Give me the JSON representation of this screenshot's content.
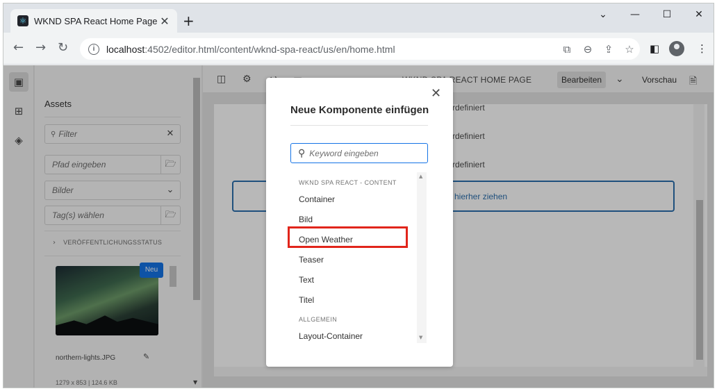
{
  "browser": {
    "tab_title": "WKND SPA React Home Page",
    "tab_close": "✕",
    "new_tab": "+",
    "window_controls": {
      "dropdown": "⌄",
      "minimize": "—",
      "maximize": "☐",
      "close": "✕"
    },
    "url_host": "localhost",
    "url_path": ":4502/editor.html/content/wknd-spa-react/us/en/home.html",
    "icons": [
      "back-icon",
      "forward-icon",
      "reload-icon",
      "site-info-icon",
      "translate-icon",
      "zoom-icon",
      "share-icon",
      "bookmark-star-icon",
      "side-panel-icon",
      "profile-icon",
      "menu-icon"
    ]
  },
  "rail": {
    "icons": [
      "assets-icon",
      "components-icon",
      "content-tree-icon"
    ]
  },
  "assets_panel": {
    "title": "Assets",
    "filter_placeholder": "Filter",
    "path_placeholder": "Pfad eingeben",
    "type_select": "Bilder",
    "tags_placeholder": "Tag(s) wählen",
    "status_section": "VERÖFFENTLICHUNGSSTATUS",
    "asset": {
      "badge": "Neu",
      "name": "northern-lights.JPG",
      "meta": "1279 x 853 | 124.6 KB"
    }
  },
  "editor": {
    "page_title": "WKND SPA REACT HOME PAGE",
    "mode_edit": "Bearbeiten",
    "mode_preview": "Vorschau",
    "canvas_lines": [
      "rdefiniert",
      "rdefiniert",
      "rdefiniert"
    ],
    "drop_text": "hierher ziehen"
  },
  "dialog": {
    "title": "Neue Komponente einfügen",
    "search_placeholder": "Keyword eingeben",
    "groups": [
      {
        "label": "WKND SPA REACT - CONTENT",
        "items": [
          "Container",
          "Bild",
          "Open Weather",
          "Teaser",
          "Text",
          "Titel"
        ]
      },
      {
        "label": "ALLGEMEIN",
        "items": [
          "Layout-Container"
        ]
      }
    ],
    "highlighted_item": "Open Weather",
    "highlight_color": "#e1251b"
  },
  "colors": {
    "accent": "#1473e6",
    "dropzone": "#2c6fad",
    "highlight": "#e1251b"
  }
}
